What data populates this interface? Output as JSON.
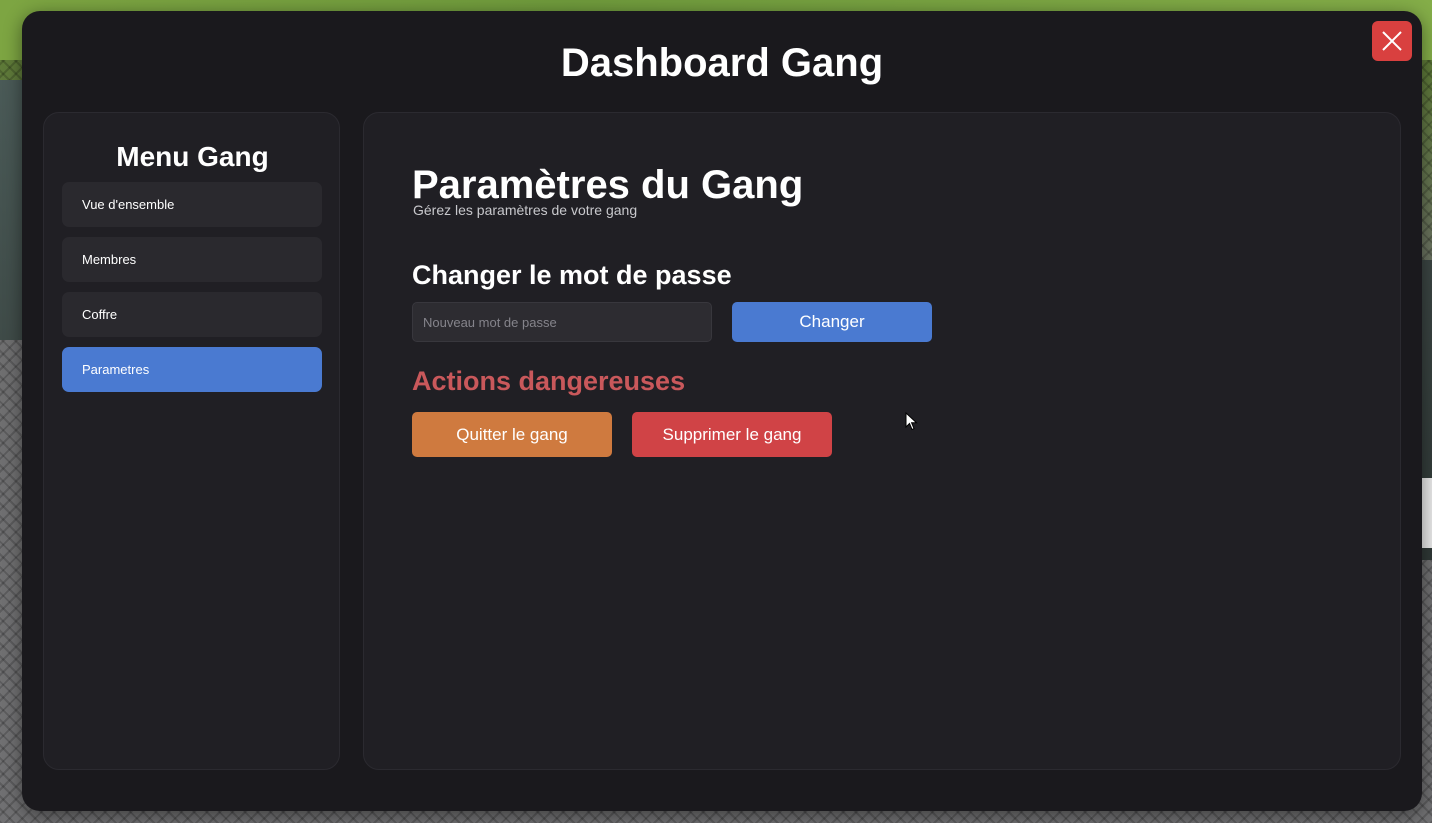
{
  "window": {
    "title": "Dashboard Gang",
    "close_icon": "close-icon"
  },
  "sidebar": {
    "title": "Menu Gang",
    "items": [
      {
        "label": "Vue d'ensemble",
        "active": false
      },
      {
        "label": "Membres",
        "active": false
      },
      {
        "label": "Coffre",
        "active": false
      },
      {
        "label": "Parametres",
        "active": true
      }
    ]
  },
  "settings": {
    "title": "Paramètres du Gang",
    "subtitle": "Gérez les paramètres de votre gang",
    "password": {
      "title": "Changer le mot de passe",
      "placeholder": "Nouveau mot de passe",
      "value": "",
      "button_label": "Changer"
    },
    "danger": {
      "title": "Actions dangereuses",
      "leave_label": "Quitter le gang",
      "delete_label": "Supprimer le gang"
    }
  },
  "colors": {
    "window_bg": "#1a191d",
    "panel_bg": "#201f24",
    "accent": "#4a7ad1",
    "danger_text": "#c9585b",
    "leave": "#cf7a3f",
    "delete": "#d04346",
    "close": "#d9403f"
  }
}
